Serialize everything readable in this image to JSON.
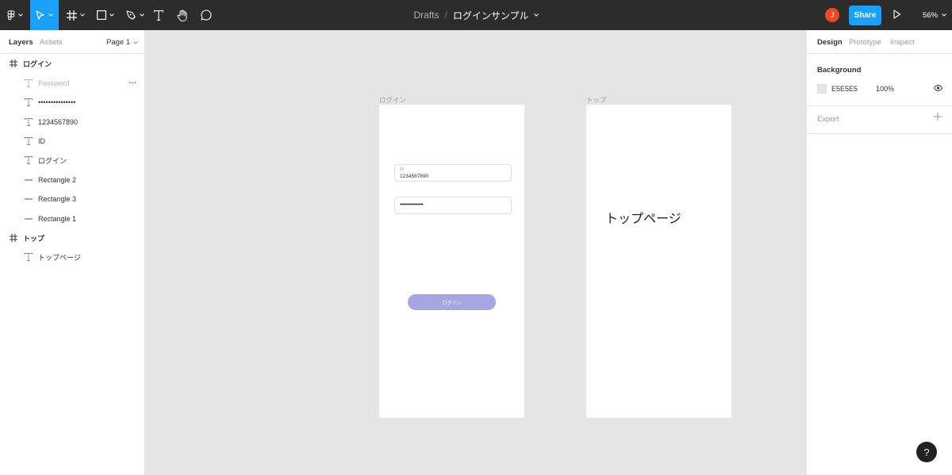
{
  "toolbar": {
    "breadcrumb_root": "Drafts",
    "breadcrumb_sep": "/",
    "file_name": "ログインサンプル",
    "avatar_initial": "J",
    "share_label": "Share",
    "zoom_label": "56%",
    "tools": [
      "figma-menu-icon",
      "move-icon",
      "frame-icon",
      "shape-icon",
      "pen-icon",
      "text-icon",
      "hand-icon",
      "comment-icon"
    ]
  },
  "left_panel": {
    "tab_layers": "Layers",
    "tab_assets": "Assets",
    "page_selector": "Page 1",
    "layers": [
      {
        "label": "ログイン",
        "type": "frame"
      },
      {
        "label": "Password",
        "type": "text",
        "hidden": true
      },
      {
        "label": "•••••••••••••••",
        "type": "text"
      },
      {
        "label": "1234567890",
        "type": "text"
      },
      {
        "label": "ID",
        "type": "text"
      },
      {
        "label": "ログイン",
        "type": "text"
      },
      {
        "label": "Rectangle 2",
        "type": "rectangle"
      },
      {
        "label": "Rectangle 3",
        "type": "rectangle"
      },
      {
        "label": "Rectangle 1",
        "type": "rectangle"
      },
      {
        "label": "トップ",
        "type": "frame"
      },
      {
        "label": "トップページ",
        "type": "text"
      }
    ]
  },
  "canvas": {
    "login_frame": {
      "label": "ログイン",
      "id_caption": "ID",
      "id_value": "1234567890",
      "password_dots": "•••••••••••••••",
      "button_label": "ログイン",
      "button_color": "#a6a6e1"
    },
    "top_frame": {
      "label": "トップ",
      "text": "トップページ"
    }
  },
  "right_panel": {
    "tab_design": "Design",
    "tab_prototype": "Prototype",
    "tab_inspect": "Inspect",
    "background_title": "Background",
    "background_hex": "E5E5E5",
    "background_opacity": "100%",
    "export_title": "Export"
  },
  "help_label": "?",
  "colors": {
    "toolbar_bg": "#2c2c2c",
    "accent": "#18a0fb",
    "canvas_bg": "#e5e5e5",
    "avatar": "#f24822"
  }
}
